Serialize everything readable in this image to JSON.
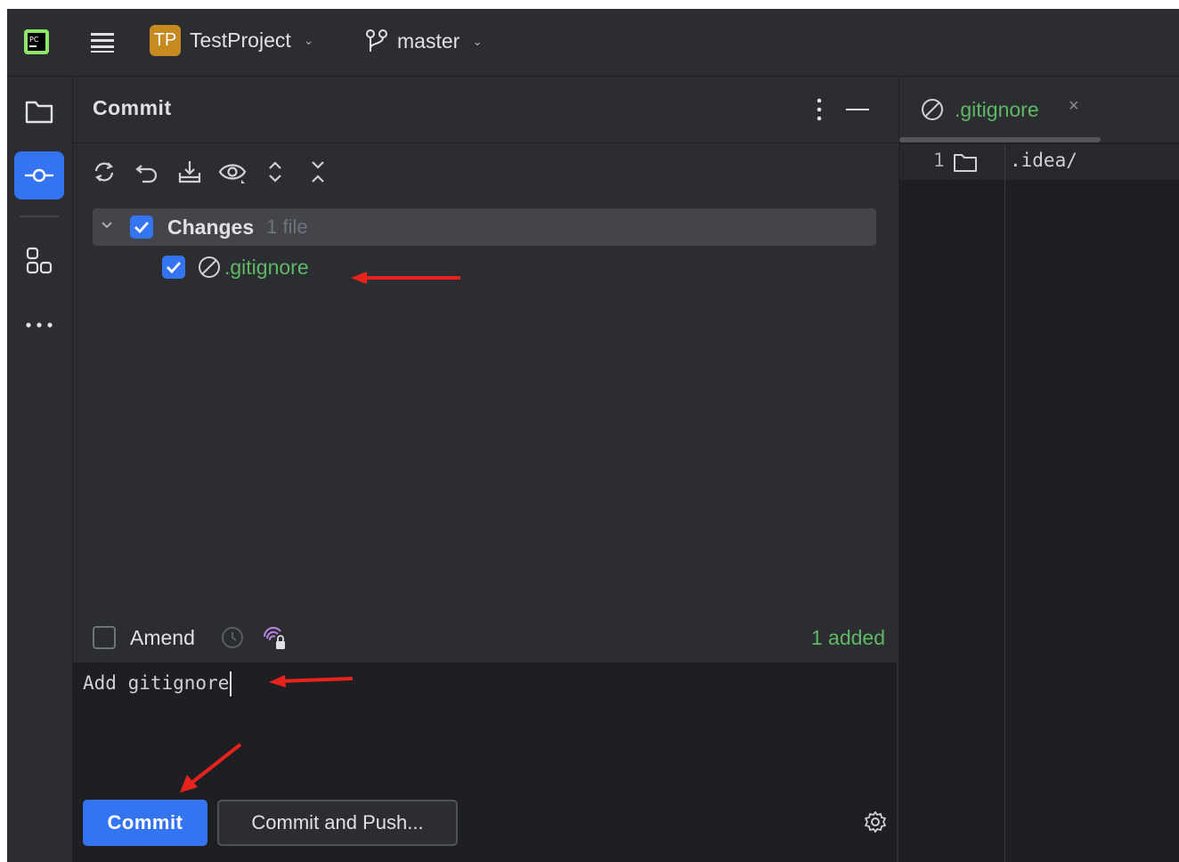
{
  "titlebar": {
    "project_badge": "TP",
    "project_name": "TestProject",
    "branch_name": "master"
  },
  "left_toolbar": {
    "items": [
      "project-view",
      "commit",
      "structure",
      "more"
    ]
  },
  "commit_panel": {
    "title": "Commit",
    "toolbar_icons": [
      "refresh-icon",
      "rollback-icon",
      "shelve-icon",
      "preview-icon",
      "expand-all-icon",
      "collapse-all-icon"
    ],
    "group": {
      "label": "Changes",
      "count": "1 file",
      "checked": true
    },
    "files": [
      {
        "name": ".gitignore",
        "status_color": "#5fb865",
        "checked": true
      }
    ],
    "amend_label": "Amend",
    "summary": "1 added",
    "message": "Add gitignore",
    "commit_button": "Commit",
    "commit_push_button": "Commit and Push..."
  },
  "editor": {
    "tab_name": ".gitignore",
    "lines": [
      {
        "number": "1",
        "text": ".idea/"
      }
    ]
  },
  "colors": {
    "accent": "#3574f0",
    "added_green": "#5fb865",
    "annotation_red": "#e8231d"
  }
}
